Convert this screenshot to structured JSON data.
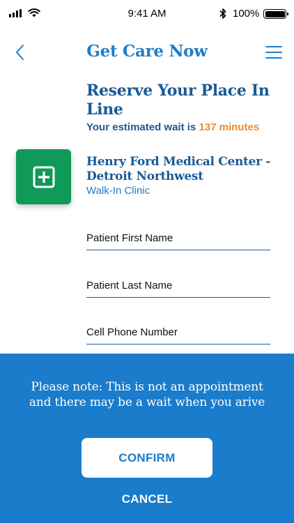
{
  "status_bar": {
    "time": "9:41 AM",
    "battery_percent": "100%",
    "icons": [
      "signal-icon",
      "wifi-icon",
      "bluetooth-icon",
      "battery-icon"
    ]
  },
  "nav": {
    "title": "Get Care Now",
    "back_icon": "chevron-left-icon",
    "menu_icon": "hamburger-menu-icon"
  },
  "reserve": {
    "title": "Reserve Your Place In Line",
    "wait_prefix": "Your estimated wait is",
    "wait_value": "137 minutes"
  },
  "clinic": {
    "icon": "medical-cross-icon",
    "name": "Henry Ford Medical Center - Detroit Northwest",
    "type": "Walk-In Clinic"
  },
  "form": {
    "first_name_placeholder": "Patient First Name",
    "last_name_placeholder": "Patient Last Name",
    "phone_placeholder": "Cell Phone Number",
    "first_name_value": "",
    "last_name_value": "",
    "phone_value": ""
  },
  "footer": {
    "note": "Please note: This is not an appointment and there may be a wait when you arive",
    "confirm_label": "CONFIRM",
    "cancel_label": "CANCEL"
  },
  "colors": {
    "primary_blue": "#1f7dc8",
    "dark_blue": "#1a5a94",
    "panel_blue": "#1a7ccb",
    "accent_orange": "#f08a2c",
    "clinic_green": "#0f9a58"
  }
}
